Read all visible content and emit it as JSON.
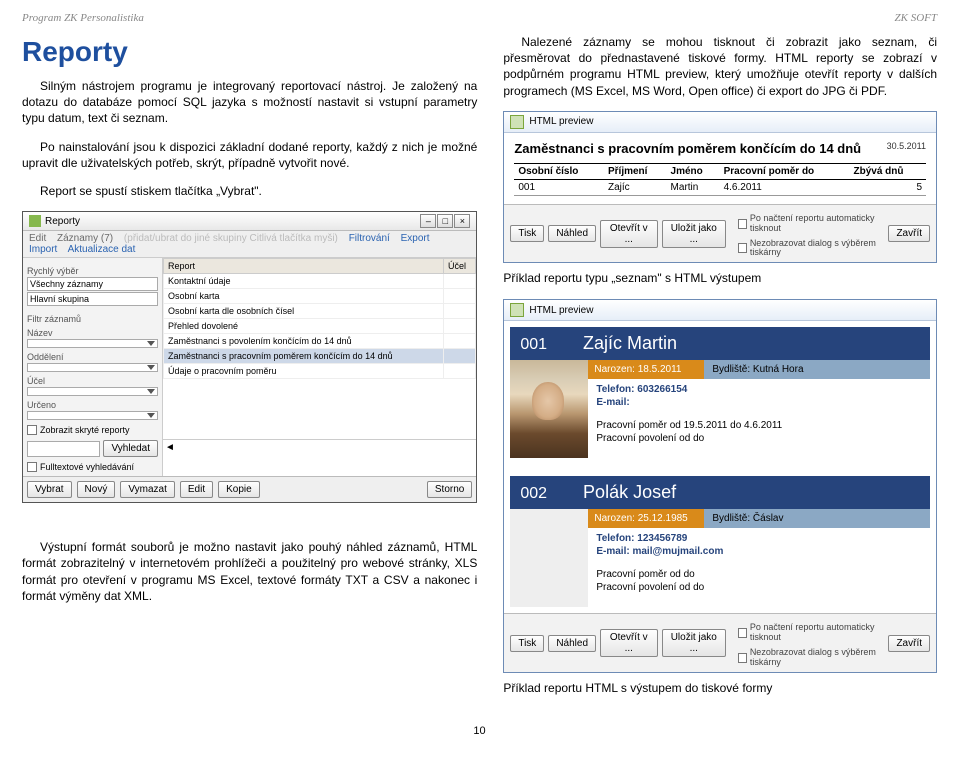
{
  "header": {
    "left": "Program ZK Personalistika",
    "right": "ZK SOFT"
  },
  "title": "Reporty",
  "para1": "Silným nástrojem programu je integrovaný reportovací nástroj. Je založený na dotazu do databáze pomocí SQL jazyka s možností nastavit si vstupní parametry typu datum, text či seznam.",
  "para2": "Po nainstalování jsou k dispozici základní dodané reporty, každý z nich je možné upravit dle uživatelských potřeb, skrýt, případně vytvořit nové.",
  "para3": "Report se spustí stiskem tlačítka „Vybrat\".",
  "para4": "Nalezené záznamy se mohou tisknout či zobrazit jako seznam, či přesměrovat do přednastavené tiskové formy. HTML reporty se zobrazí v podpůrném programu HTML preview, který umožňuje otevřít reporty v dalších programech (MS Excel, MS Word, Open office) či export do JPG či PDF.",
  "para5": "Výstupní formát souborů je možno nastavit jako pouhý náhled záznamů, HTML formát zobrazitelný v internetovém prohlížeči a použitelný pro webové stránky, XLS formát pro otevření v programu MS Excel, textové formáty TXT a CSV a nakonec i formát výměny dat XML.",
  "reportWin": {
    "title": "Reporty",
    "menu": [
      "Edit",
      "Záznamy (7)",
      "(přidat/ubrat do jiné skupiny Citlivá tlačítka myši)",
      "Filtrování",
      "Export",
      "Import",
      "Aktualizace dat"
    ],
    "left": {
      "rychly": "Rychlý výběr",
      "vsechny": "Všechny záznamy",
      "hlavni": "Hlavní skupina",
      "filtr": "Filtr záznamů",
      "nazev": "Název",
      "oddeleni": "Oddělení",
      "ucel": "Účel",
      "urceno": "Určeno",
      "zobrazit": "Zobrazit skryté reporty",
      "vyhledat": "Vyhledat",
      "fulltext": "Fulltextové vyhledávání"
    },
    "tableHead": [
      "Report",
      "Účel"
    ],
    "rows": [
      "Kontaktní údaje",
      "Osobní karta",
      "Osobní karta dle osobních čísel",
      "Přehled dovolené",
      "Zaměstnanci s povolením končícím do 14 dnů",
      "Zaměstnanci s pracovním poměrem končícím do 14 dnů",
      "Údaje o pracovním poměru"
    ],
    "selectedRow": 5,
    "footer": [
      "Vybrat",
      "Nový",
      "Vymazat",
      "Edit",
      "Kopie",
      "Storno"
    ]
  },
  "preview1": {
    "title": "HTML preview",
    "heading": "Zaměstnanci s pracovním poměrem končícím do 14 dnů",
    "date": "30.5.2011",
    "cols": [
      "Osobní číslo",
      "Příjmení",
      "Jméno",
      "Pracovní poměr do",
      "Zbývá dnů"
    ],
    "row": [
      "001",
      "Zajíc",
      "Martin",
      "4.6.2011",
      "5"
    ],
    "btns": [
      "Tisk",
      "Náhled",
      "Otevřít v ...",
      "Uložit jako ..."
    ],
    "auto1": "Po načtení reportu automaticky tisknout",
    "auto2": "Nezobrazovat dialog s výběrem tiskárny",
    "close": "Zavřít"
  },
  "caption1": "Příklad reportu typu „seznam\" s HTML výstupem",
  "preview2": {
    "title": "HTML preview"
  },
  "card1": {
    "num": "001",
    "name": "Zajíc Martin",
    "born": "Narozen: 18.5.2011",
    "addr": "Bydliště: Kutná Hora",
    "tel": "Telefon: 603266154",
    "email": "E-mail:",
    "line1": "Pracovní poměr od 19.5.2011 do 4.6.2011",
    "line2": "Pracovní povolení od do"
  },
  "card2": {
    "num": "002",
    "name": "Polák Josef",
    "born": "Narozen: 25.12.1985",
    "addr": "Bydliště: Čáslav",
    "tel": "Telefon: 123456789",
    "email": "E-mail: mail@mujmail.com",
    "line1": "Pracovní poměr od do",
    "line2": "Pracovní povolení od do"
  },
  "caption2": "Příklad reportu HTML s výstupem do tiskové formy",
  "pageNum": "10"
}
